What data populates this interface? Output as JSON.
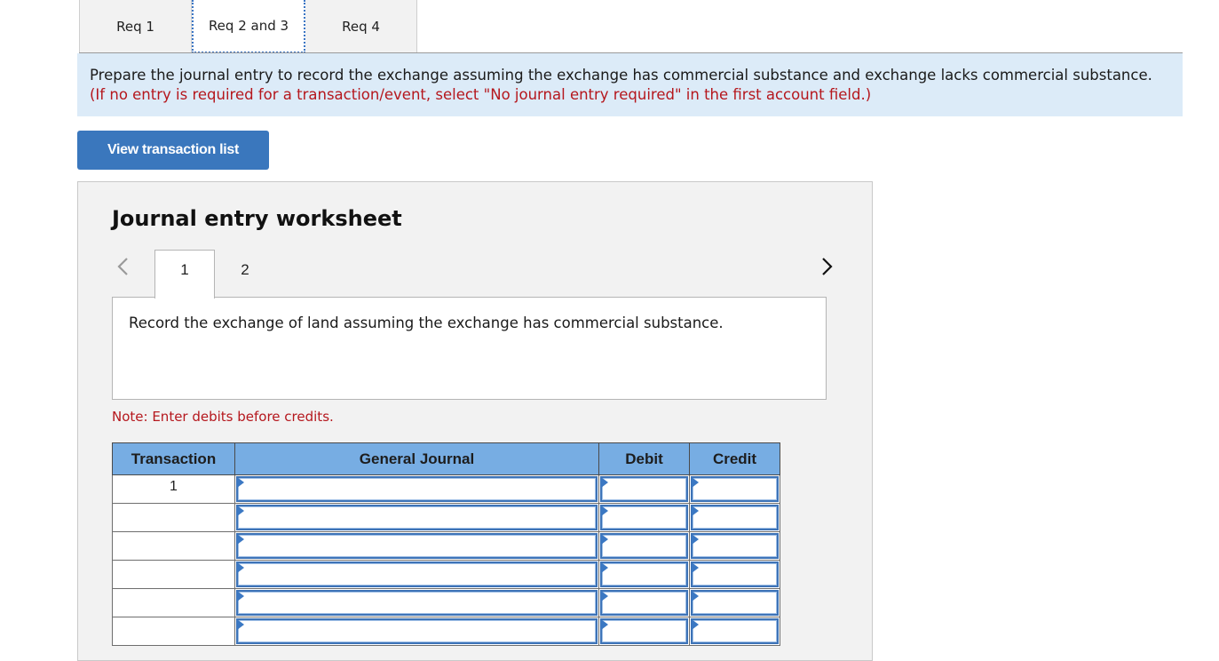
{
  "req_tabs": [
    {
      "label": "Req 1",
      "active": false
    },
    {
      "label": "Req 2 and 3",
      "active": true
    },
    {
      "label": "Req 4",
      "active": false
    }
  ],
  "banner": {
    "instruction": "Prepare the journal entry to record the exchange assuming the exchange has commercial substance and exchange lacks commercial substance.",
    "hint": "(If no entry is required for a transaction/event, select \"No journal entry required\" in the first account field.)"
  },
  "view_transaction_button": "View transaction list",
  "worksheet": {
    "title": "Journal entry worksheet",
    "prev_icon": "chevron-left-icon",
    "next_icon": "chevron-right-icon",
    "steps": [
      {
        "label": "1",
        "active": true
      },
      {
        "label": "2",
        "active": false
      }
    ],
    "description": "Record the exchange of land assuming the exchange has commercial substance.",
    "note": "Note: Enter debits before credits.",
    "table": {
      "headers": {
        "transaction": "Transaction",
        "general_journal": "General Journal",
        "debit": "Debit",
        "credit": "Credit"
      },
      "rows": [
        {
          "transaction": "1",
          "account": "",
          "debit": "",
          "credit": ""
        },
        {
          "transaction": "",
          "account": "",
          "debit": "",
          "credit": ""
        },
        {
          "transaction": "",
          "account": "",
          "debit": "",
          "credit": ""
        },
        {
          "transaction": "",
          "account": "",
          "debit": "",
          "credit": ""
        },
        {
          "transaction": "",
          "account": "",
          "debit": "",
          "credit": ""
        },
        {
          "transaction": "",
          "account": "",
          "debit": "",
          "credit": ""
        }
      ]
    }
  },
  "colors": {
    "accent_blue": "#3a77bd",
    "banner_bg": "#dcebf8",
    "hint_red": "#b5171d",
    "table_header_bg": "#77ade3"
  }
}
